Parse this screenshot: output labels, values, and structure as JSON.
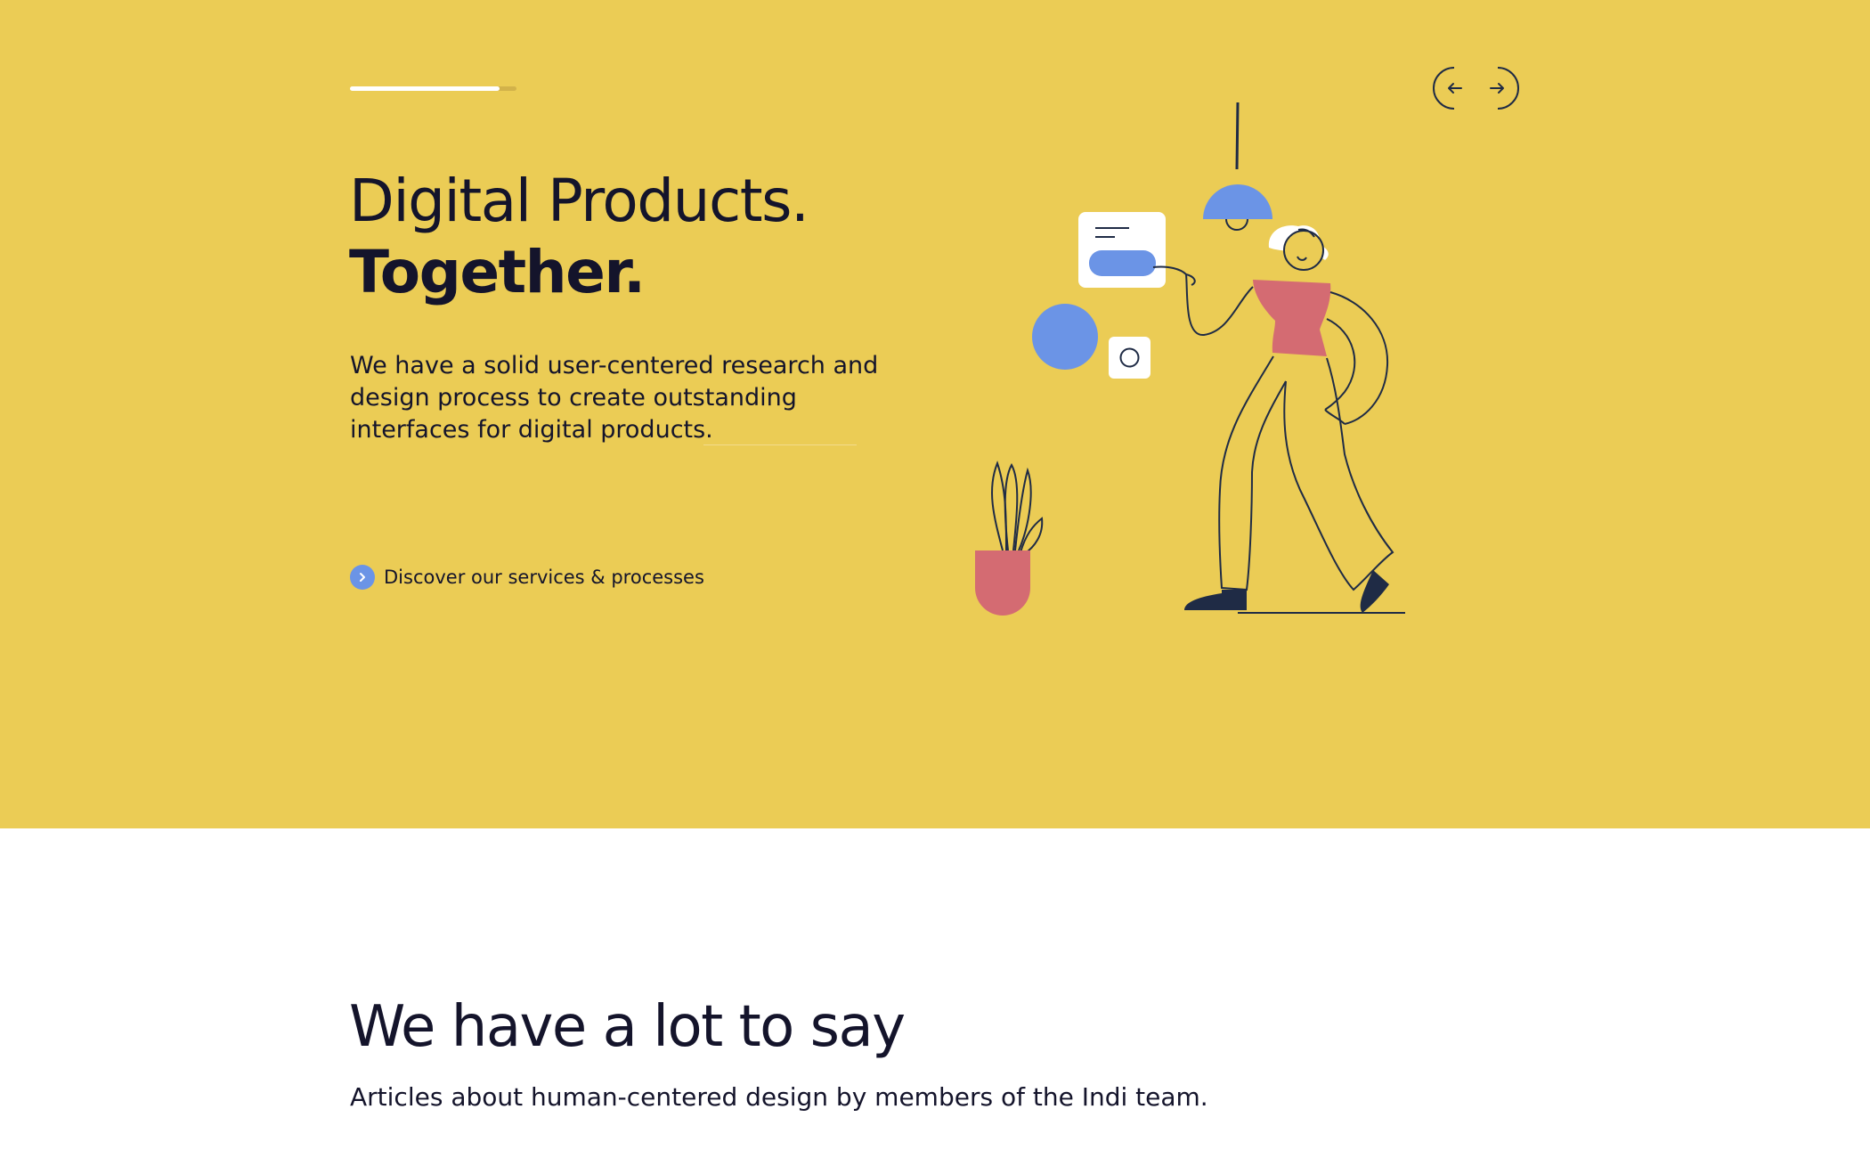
{
  "hero": {
    "slide_progress": 0.9,
    "title_line1": "Digital Products.",
    "title_line2": "Together.",
    "description": "We have a solid user-centered research and design process to create outstanding interfaces for digital products.",
    "cta_label": "Discover our services & processes",
    "background_color": "#ebcc55",
    "nav": {
      "prev_icon": "arrow-left-icon",
      "next_icon": "arrow-right-icon"
    },
    "illustration": {
      "accent_blue": "#6b94e6",
      "accent_red": "#d46b72",
      "ink": "#1f2b45"
    }
  },
  "articles": {
    "title": "We have a lot to say",
    "subtitle": "Articles about human-centered design by members of the Indi team."
  }
}
